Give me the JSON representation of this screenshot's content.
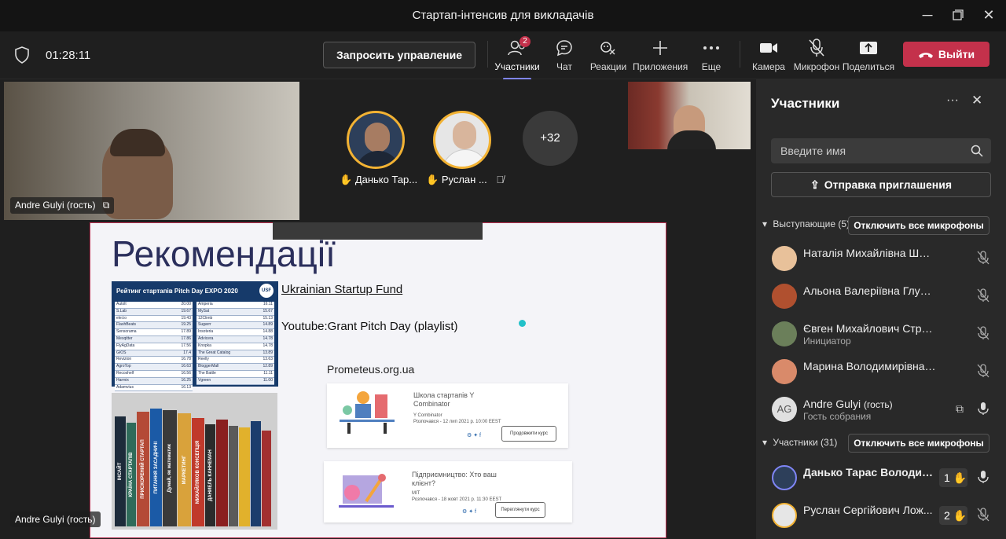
{
  "window": {
    "title": "Стартап-інтенсив для викладачів"
  },
  "toolbar": {
    "timer": "01:28:11",
    "request_control": "Запросить управление",
    "participants_label": "Участники",
    "participants_badge": "2",
    "chat_label": "Чат",
    "reactions_label": "Реакции",
    "apps_label": "Приложения",
    "more_label": "Еще",
    "camera_label": "Камера",
    "mic_label": "Микрофон",
    "share_label": "Поделиться",
    "leave_label": "Выйти"
  },
  "stage": {
    "video_main_name": "Andre Gulyi (гость)",
    "raised1_name": "Данько Тар...",
    "raised2_name": "Руслан ...",
    "overflow_count": "+32",
    "share_owner": "Andre Gulyi (гость)"
  },
  "slide": {
    "title": "Рекомендації",
    "rating_title": "Рейтинг стартапів Pitch Day EXPO 2020",
    "usf_badge": "USF",
    "rating_left": [
      [
        "Autolt",
        "20.00"
      ],
      [
        "S.Lab",
        "19.67"
      ],
      [
        "elei.io",
        "19.43"
      ],
      [
        "FlashBeats",
        "19.25"
      ],
      [
        "Sensorama",
        "17.89"
      ],
      [
        "Mesqitter",
        "17.86"
      ],
      [
        "FlyAgData",
        "17.56"
      ],
      [
        "GIOS",
        "17.4"
      ],
      [
        "Revizion",
        "16.78"
      ],
      [
        "AgroTop",
        "16.63"
      ],
      [
        "Recoshelf",
        "16.56"
      ],
      [
        "Harmix",
        "16.25"
      ],
      [
        "Adamvius",
        "16.13"
      ]
    ],
    "rating_right": [
      [
        "Amperia",
        "16.11"
      ],
      [
        "MySat",
        "15.67"
      ],
      [
        "12Climb",
        "15.13"
      ],
      [
        "Sugarrr",
        "14.89"
      ],
      [
        "Insoteria",
        "14.88"
      ],
      [
        "Advicera",
        "14.78"
      ],
      [
        "Knopka",
        "14.78"
      ],
      [
        "The Great Catalog",
        "13.89"
      ],
      [
        "Reelly",
        "13.63"
      ],
      [
        "BloggerMall",
        "12.89"
      ],
      [
        "The Battle",
        "11.11"
      ],
      [
        "Vgreen",
        "11.00"
      ]
    ],
    "link1": "Ukrainian Startup Fund",
    "link2": "Youtube:Grant Pitch Day (playlist)",
    "link3": "Prometeus.org.ua",
    "books": [
      "ІНСАЙТ",
      "КРАЇНА СТАРТАПІВ",
      "ПРИСКОРЕНИЙ СТАРТАП",
      "ПИТАННЯ ЗАСАДНИЧІ",
      "Думай, як математик",
      "МАРКЕТИНГ",
      "МИХАЙЛЯКОВ КОНСЕПЦІЯ",
      "ДАНИЕЛЬ КАННЕМАН"
    ],
    "course1": {
      "title": "Школа стартапів Y Combinator",
      "org": "Y Combinator",
      "date": "Розпочався - 12 лип 2021 р. 10:00 EEST",
      "button": "Продовжити курс"
    },
    "course2": {
      "title": "Підприємництво: Хто ваш клієнт?",
      "org": "MIT",
      "date": "Розпочався - 18 жовт 2021 р. 11:30 EEST",
      "button": "Переглянути курс"
    }
  },
  "panel": {
    "title": "Участники",
    "search_placeholder": "Введите имя",
    "invite_label": "Отправка приглашения",
    "presenters_header": "Выступающие (5)",
    "mute_all_1": "Отключить все микрофоны",
    "attendees_header": "Участники (31)",
    "mute_all_2": "Отключить все микрофоны",
    "presenters": [
      {
        "name": "Наталія Михайлівна Шматько",
        "sub": ""
      },
      {
        "name": "Альона Валеріївна Глушко",
        "sub": ""
      },
      {
        "name": "Євген Михайлович Строков",
        "sub": "Инициатор"
      },
      {
        "name": "Марина Володимирівна Карміз...",
        "sub": ""
      },
      {
        "name": "Andre Gulyi",
        "name_suffix": "(гость)",
        "sub": "Гость собрания",
        "initials": "AG"
      }
    ],
    "attendees": [
      {
        "name": "Данько Тарас Володим...",
        "hand": "1"
      },
      {
        "name": "Руслан Сергійович Лож...",
        "hand": "2"
      }
    ]
  },
  "colors": {
    "accent": "#7f85f5",
    "leave": "#c4314b",
    "hand": "#f2b233"
  }
}
